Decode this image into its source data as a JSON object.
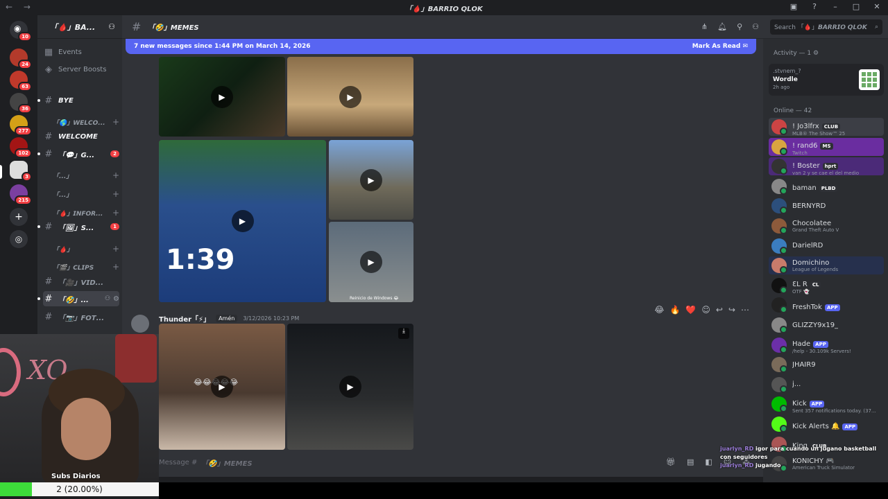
{
  "window": {
    "title": "「🩸」𝘽𝘼𝙍𝙍𝙄𝙊 𝙌𝙇𝙊𝙆",
    "nav": "← →"
  },
  "servers": [
    {
      "badge": "10",
      "color": "#5865f2"
    },
    {
      "badge": "24",
      "color": "#b33a2b"
    },
    {
      "badge": "63",
      "color": "#c0392b"
    },
    {
      "badge": "36",
      "color": "#444"
    },
    {
      "badge": "277",
      "color": "#d4a017"
    },
    {
      "badge": "102",
      "color": "#a31515"
    },
    {
      "badge": "3",
      "color": "#ddd"
    },
    {
      "badge": "215",
      "color": "#7b3fa0"
    }
  ],
  "guild": {
    "name": "「🩸」𝘽𝘼...",
    "events": "Events",
    "boosts": "Server Boosts"
  },
  "channels": [
    {
      "icon": "#",
      "label": "𝘽𝙔𝙀",
      "kind": "channel"
    },
    {
      "icon": "",
      "label": "「🌎」𝙒𝙀𝙇𝘾𝙊...",
      "kind": "category"
    },
    {
      "icon": "#",
      "label": "𝙒𝙀𝙇𝘾𝙊𝙈𝙀",
      "kind": "channel"
    },
    {
      "icon": "#",
      "label": "「💬」𝙂...",
      "kind": "channel",
      "badge": "2"
    },
    {
      "icon": "",
      "label": "「...」",
      "kind": "category"
    },
    {
      "icon": "",
      "label": "「...」",
      "kind": "category"
    },
    {
      "icon": "",
      "label": "「🩸」𝙄𝙉𝙁𝙊𝙍...",
      "kind": "category"
    },
    {
      "icon": "#",
      "label": "「🖼」𝙎...",
      "kind": "channel",
      "badge": "1"
    },
    {
      "icon": "",
      "label": "「🩸」",
      "kind": "category"
    },
    {
      "icon": "",
      "label": "「🎬」𝘾𝙇𝙄𝙋𝙎",
      "kind": "category"
    },
    {
      "icon": "#",
      "label": "「🎥」𝙑𝙄𝘿...",
      "kind": "channel"
    },
    {
      "icon": "#",
      "label": "「🤣」...",
      "kind": "channel",
      "selected": true
    },
    {
      "icon": "#",
      "label": "「📷」𝙁𝙊𝙏...",
      "kind": "channel"
    }
  ],
  "channel": {
    "name": "「🤣」𝙈𝙀𝙈𝙀𝙎",
    "search_placeholder": "Search 「🩸」𝘽𝘼𝙍𝙍𝙄𝙊 𝙌𝙇𝙊𝙆"
  },
  "banner": {
    "text": "7 new messages since 1:44 PM on March 14, 2026",
    "action": "Mark As Read"
  },
  "message": {
    "author": "Thunder「⚡」",
    "role": "Amén",
    "time": "3/12/2026 10:23 PM",
    "caption": "Reinicio de Windows 😂",
    "video_emoji": "😂😂😂😂😂"
  },
  "reactions": [
    "😂",
    "🔥",
    "❤️"
  ],
  "composer": {
    "placeholder": "Message #",
    "channel": "「🤣」𝙈𝙀𝙈𝙀𝙎"
  },
  "members": {
    "activity_header": "Activity — 1",
    "activity": {
      "user": ".stvnem_?",
      "game": "Wordle",
      "time": "2h ago"
    },
    "online_header": "Online — 42",
    "list": [
      {
        "name": "! Jo3lfrx",
        "sub": "MLB® The Show™ 25",
        "tag": "CLUB",
        "tagType": "club",
        "color": "#c44",
        "bg": "#3c3e45"
      },
      {
        "name": "! rand6",
        "sub": "Twitch",
        "tag": "ΜS",
        "tagType": "club",
        "color": "#d9a441",
        "bg": "#6a2da0"
      },
      {
        "name": "! Boster",
        "sub": "van 2 y se cae el del medio",
        "tag": "hprt",
        "tagType": "club",
        "color": "#333",
        "bg": "#4b2a78"
      },
      {
        "name": "baman",
        "sub": "",
        "tag": "PLBD",
        "tagType": "club",
        "color": "#888"
      },
      {
        "name": "BERNYRD",
        "sub": "",
        "tag": "",
        "color": "#2c4f7c"
      },
      {
        "name": "Chocolatee",
        "sub": "Grand Theft Auto V",
        "tag": "",
        "color": "#8d5a3b"
      },
      {
        "name": "DarielRD",
        "sub": "",
        "tag": "",
        "color": "#3b7dbf"
      },
      {
        "name": "Domichino",
        "sub": "League of Legends",
        "tag": "",
        "color": "#c87b6b",
        "bg": "#26304d"
      },
      {
        "name": "ƐL R",
        "sub": "OTF 👻",
        "tag": "CL",
        "tagType": "club",
        "color": "#111"
      },
      {
        "name": "FreshTok",
        "sub": "",
        "tag": "APP",
        "tagType": "app",
        "color": "#222"
      },
      {
        "name": "GLIZZY9x19_",
        "sub": "",
        "tag": "",
        "color": "#888"
      },
      {
        "name": "Hade",
        "sub": "/help - 30.109k Servers!",
        "tag": "APP",
        "tagType": "app",
        "color": "#6b2fa8"
      },
      {
        "name": "JHAIR9",
        "sub": "",
        "tag": "",
        "color": "#7a6b5a"
      },
      {
        "name": "j...",
        "sub": "",
        "tag": "",
        "color": "#555"
      },
      {
        "name": "Kick",
        "sub": "Sent 357 notifications today. (37...",
        "tag": "APP",
        "tagType": "app",
        "color": "#0b0"
      },
      {
        "name": "Kick Alerts 🔔",
        "sub": "",
        "tag": "APP",
        "tagType": "app",
        "color": "#53fc18"
      },
      {
        "name": "King",
        "sub": "",
        "tag": "CLUB",
        "tagType": "club",
        "color": "#a55"
      },
      {
        "name": "KONICHY 🎮",
        "sub": "American Truck Simulator",
        "tag": "",
        "color": "#444"
      }
    ]
  },
  "stream": {
    "subs_label": "Subs Diarios",
    "progress_text": "2 (20.00%)",
    "progress_fraction": 0.2,
    "webcam_text": "XO",
    "chat": [
      {
        "user": "juarlyn_RD",
        "text": "igor para cuando un jugano basketball con seguidores"
      },
      {
        "user": "juarlyn_RD",
        "text": "jugando"
      }
    ]
  }
}
